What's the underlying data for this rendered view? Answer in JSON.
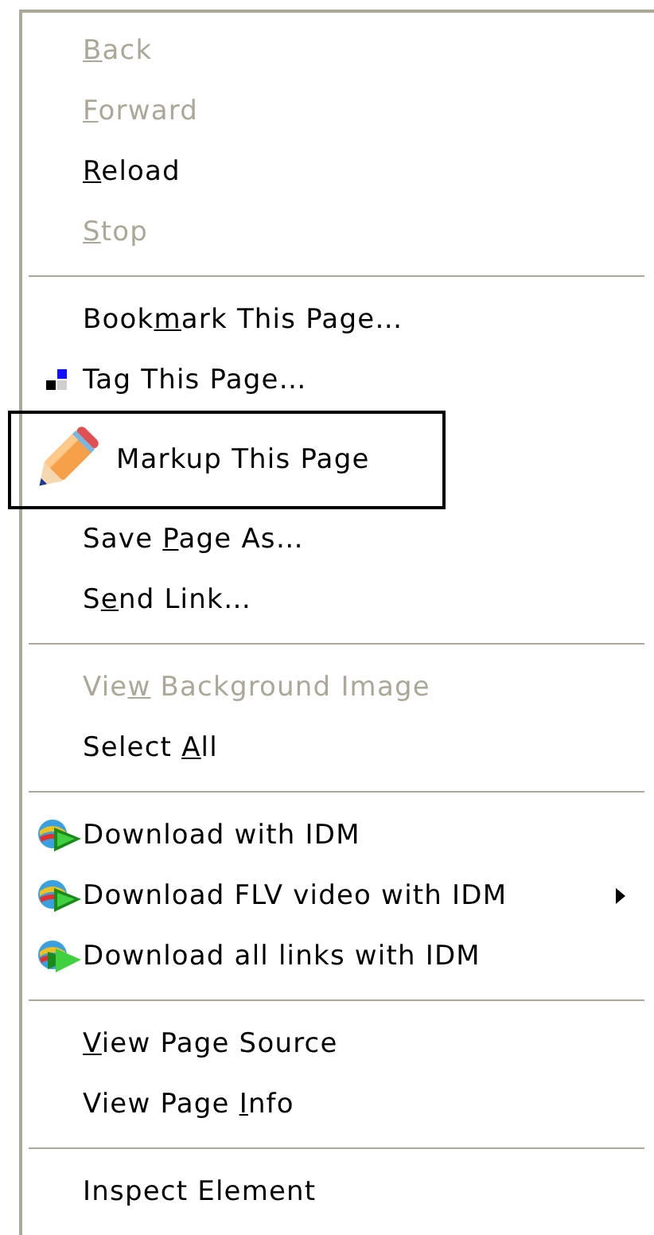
{
  "menu": {
    "items": [
      {
        "kind": "item",
        "label": [
          {
            "text": "B",
            "underlined": true
          },
          {
            "text": "ack",
            "underlined": false
          }
        ],
        "disabled": true
      },
      {
        "kind": "item",
        "label": [
          {
            "text": "F",
            "underlined": true
          },
          {
            "text": "orward",
            "underlined": false
          }
        ],
        "disabled": true
      },
      {
        "kind": "item",
        "label": [
          {
            "text": "R",
            "underlined": true
          },
          {
            "text": "eload",
            "underlined": false
          }
        ],
        "disabled": false
      },
      {
        "kind": "item",
        "label": [
          {
            "text": "S",
            "underlined": true
          },
          {
            "text": "top",
            "underlined": false
          }
        ],
        "disabled": true
      },
      {
        "kind": "separator"
      },
      {
        "kind": "item",
        "label": [
          {
            "text": "Book",
            "underlined": false
          },
          {
            "text": "m",
            "underlined": true
          },
          {
            "text": "ark This Page…",
            "underlined": false
          }
        ],
        "disabled": false
      },
      {
        "kind": "tag",
        "label": [
          {
            "text": "Tag This Page…",
            "underlined": false
          }
        ],
        "disabled": false
      },
      {
        "kind": "markup",
        "label": [
          {
            "text": "Markup This Page",
            "underlined": false
          }
        ],
        "focused": true,
        "disabled": false
      },
      {
        "kind": "item",
        "label": [
          {
            "text": "Save ",
            "underlined": false
          },
          {
            "text": "P",
            "underlined": true
          },
          {
            "text": "age As…",
            "underlined": false
          }
        ],
        "disabled": false
      },
      {
        "kind": "item",
        "label": [
          {
            "text": "S",
            "underlined": false
          },
          {
            "text": "e",
            "underlined": true
          },
          {
            "text": "nd Link…",
            "underlined": false
          }
        ],
        "disabled": false
      },
      {
        "kind": "separator"
      },
      {
        "kind": "item",
        "label": [
          {
            "text": "Vie",
            "underlined": false
          },
          {
            "text": "w",
            "underlined": true
          },
          {
            "text": " Background Image",
            "underlined": false
          }
        ],
        "disabled": true
      },
      {
        "kind": "item",
        "label": [
          {
            "text": "Select ",
            "underlined": false
          },
          {
            "text": "A",
            "underlined": true
          },
          {
            "text": "ll",
            "underlined": false
          }
        ],
        "disabled": false
      },
      {
        "kind": "separator"
      },
      {
        "kind": "download",
        "label": [
          {
            "text": "Download with IDM",
            "underlined": false
          }
        ],
        "disabled": false
      },
      {
        "kind": "download",
        "label": [
          {
            "text": "Download FLV video with IDM",
            "underlined": false
          }
        ],
        "submenu": true,
        "disabled": false
      },
      {
        "kind": "download-all",
        "label": [
          {
            "text": "Download all links with IDM",
            "underlined": false
          }
        ],
        "disabled": false
      },
      {
        "kind": "separator"
      },
      {
        "kind": "item",
        "label": [
          {
            "text": "V",
            "underlined": true
          },
          {
            "text": "iew Page Source",
            "underlined": false
          }
        ],
        "disabled": false
      },
      {
        "kind": "item",
        "label": [
          {
            "text": "View Page ",
            "underlined": false
          },
          {
            "text": "I",
            "underlined": true
          },
          {
            "text": "nfo",
            "underlined": false
          }
        ],
        "disabled": false
      },
      {
        "kind": "separator"
      },
      {
        "kind": "item",
        "label": [
          {
            "text": "Inspect Element",
            "underlined": false
          }
        ],
        "disabled": false
      }
    ]
  }
}
